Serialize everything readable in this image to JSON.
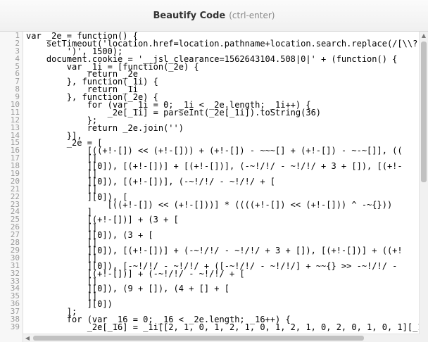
{
  "dialog": {
    "title": "Beautify Code",
    "shortcut": "(ctrl-enter)"
  },
  "code_lines": [
    {
      "n": "1",
      "text": "var _2e = function() {"
    },
    {
      "n": "2",
      "text": "    setTimeout('location.href=location.pathname+location.search.replace(/[\\\\?|"
    },
    {
      "n": "3",
      "text": "        ')', 1500);"
    },
    {
      "n": "4",
      "text": "    document.cookie = '__jsl_clearance=1562643104.508|0|' + (function() {"
    },
    {
      "n": "5",
      "text": "        var _1i = [function(_2e) {"
    },
    {
      "n": "6",
      "text": "            return _2e"
    },
    {
      "n": "7",
      "text": "        }, function(_1i) {"
    },
    {
      "n": "8",
      "text": "            return _1i"
    },
    {
      "n": "9",
      "text": "        }, function(_2e) {"
    },
    {
      "n": "10",
      "text": "            for (var _1i = 0; _1i < _2e.length; _1i++) {"
    },
    {
      "n": "11",
      "text": "                _2e[_1i] = parseInt(_2e[_1i]).toString(36)"
    },
    {
      "n": "12",
      "text": "            };"
    },
    {
      "n": "13",
      "text": "            return _2e.join('')"
    },
    {
      "n": "14",
      "text": "        }],"
    },
    {
      "n": "15",
      "text": "        _2e = ["
    },
    {
      "n": "16",
      "text": "            [((+!-[]) << (+!-[])) + (+!-[]) - ~~~[] + (+!-[]) - ~-~[]], (("
    },
    {
      "n": "17",
      "text": "            []"
    },
    {
      "n": "18",
      "text": "            ][0]), [(+!-[])] + [(+!-[])], (-~!/!/ - ~!/!/ + 3 + []), [(+!-"
    },
    {
      "n": "19",
      "text": "            []"
    },
    {
      "n": "20",
      "text": "            ][0]), [(+!-[])], (-~!/!/ - ~!/!/ + ["
    },
    {
      "n": "21",
      "text": "            []"
    },
    {
      "n": "22",
      "text": "            ][0]), ["
    },
    {
      "n": "23",
      "text": "                [((+!-[]) << (+!-[]))] * ((((+!-[]) << (+!-[])) ^ -~{}))"
    },
    {
      "n": "24",
      "text": "            ]"
    },
    {
      "n": "25",
      "text": "            [(+!-[])] + (3 + ["
    },
    {
      "n": "26",
      "text": "            []"
    },
    {
      "n": "27",
      "text": "            ][0]), (3 + ["
    },
    {
      "n": "28",
      "text": "            []"
    },
    {
      "n": "29",
      "text": "            ][0]), [(+!-[])] + (-~!/!/ - ~!/!/ + 3 + []), [(+!-[])] + ((+!"
    },
    {
      "n": "30",
      "text": "            []"
    },
    {
      "n": "31",
      "text": "            ][0]), [-~!/!/ - ~!/!/ + ([-~!/!/ - ~!/!/] + ~~{} >> -~!/!/ -"
    },
    {
      "n": "32",
      "text": "            [(+!-[])] + (-~!/!/ - ~!/!/ + ["
    },
    {
      "n": "33",
      "text": "            []"
    },
    {
      "n": "34",
      "text": "            ][0]), (9 + []), (4 + [] + ["
    },
    {
      "n": "35",
      "text": "            []"
    },
    {
      "n": "36",
      "text": "            ][0])"
    },
    {
      "n": "37",
      "text": "        ];"
    },
    {
      "n": "38",
      "text": "        for (var _16 = 0; _16 < _2e.length; _16++) {"
    },
    {
      "n": "39",
      "text": "            _2e[_16] = _1i[[2, 1, 0, 1, 2, 1, 0, 1, 2, 1, 0, 2, 0, 1, 0, 1][_1"
    }
  ],
  "icons": {
    "up": "▲",
    "down": "▼",
    "left": "◀",
    "right": "▶"
  },
  "colors": {
    "text": "#000000",
    "gutter": "#f7f7f7",
    "line_number": "#999999"
  }
}
